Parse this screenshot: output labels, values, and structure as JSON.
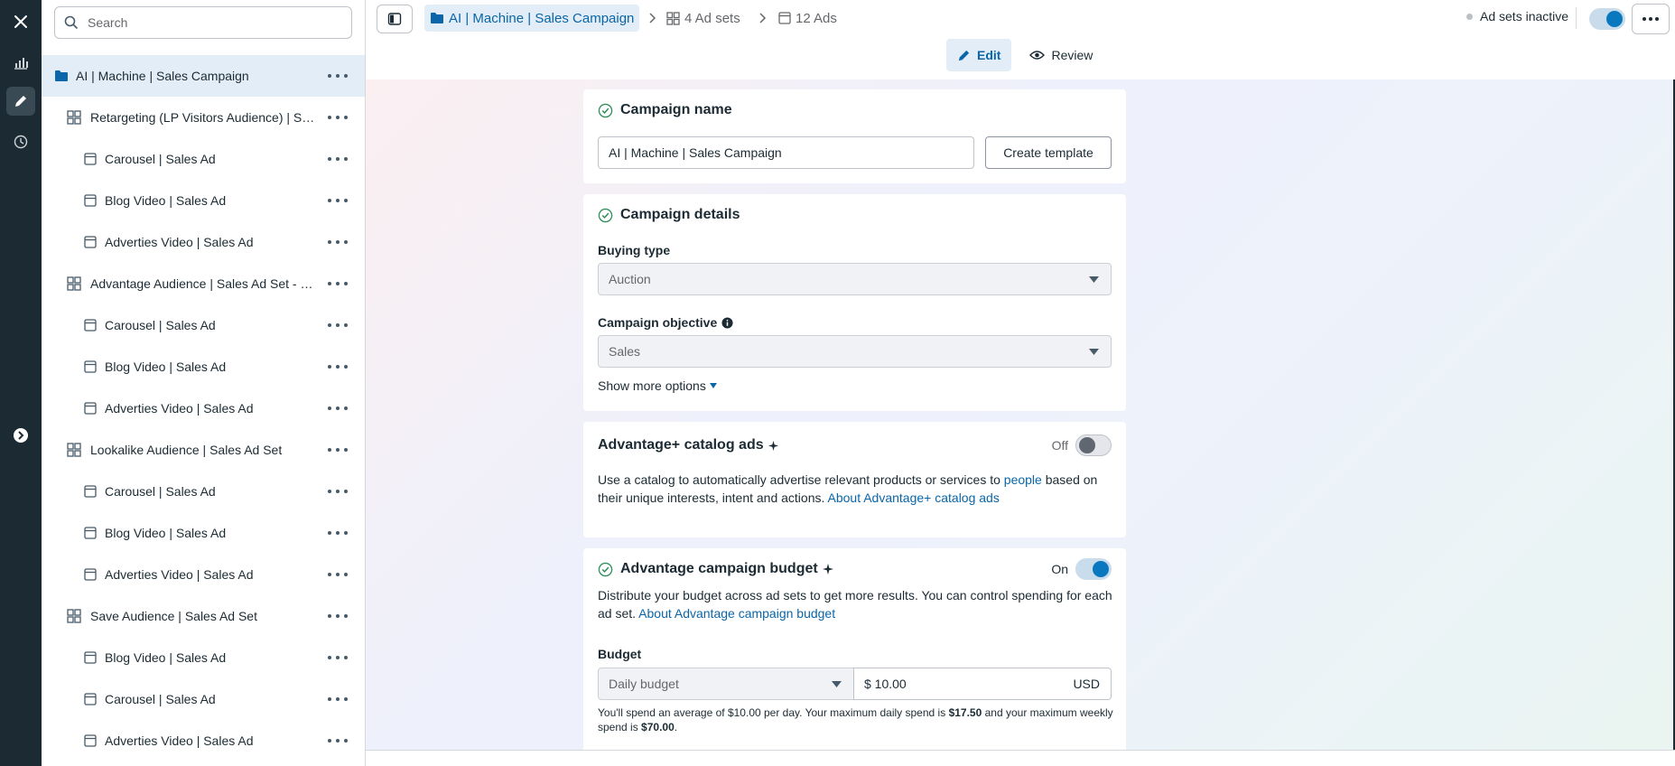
{
  "sidebar": {
    "search_placeholder": "Search",
    "items": [
      {
        "label": "AI | Machine | Sales Campaign",
        "type": "campaign"
      },
      {
        "label": "Retargeting (LP Visitors Audience) | Sal...",
        "type": "adset"
      },
      {
        "label": "Carousel | Sales Ad",
        "type": "ad"
      },
      {
        "label": "Blog Video | Sales Ad",
        "type": "ad"
      },
      {
        "label": "Adverties Video | Sales Ad",
        "type": "ad"
      },
      {
        "label": "Advantage Audience | Sales Ad Set - C...",
        "type": "adset"
      },
      {
        "label": "Carousel | Sales Ad",
        "type": "ad"
      },
      {
        "label": "Blog Video | Sales Ad",
        "type": "ad"
      },
      {
        "label": "Adverties Video | Sales Ad",
        "type": "ad"
      },
      {
        "label": "Lookalike Audience | Sales Ad Set",
        "type": "adset"
      },
      {
        "label": "Carousel | Sales Ad",
        "type": "ad"
      },
      {
        "label": "Blog Video | Sales Ad",
        "type": "ad"
      },
      {
        "label": "Adverties Video | Sales Ad",
        "type": "ad"
      },
      {
        "label": "Save Audience | Sales Ad Set",
        "type": "adset"
      },
      {
        "label": "Blog Video | Sales Ad",
        "type": "ad"
      },
      {
        "label": "Carousel | Sales Ad",
        "type": "ad"
      },
      {
        "label": "Adverties Video | Sales Ad",
        "type": "ad"
      }
    ]
  },
  "header": {
    "breadcrumb_campaign": "AI | Machine | Sales Campaign",
    "breadcrumb_adsets": "4 Ad sets",
    "breadcrumb_ads": "12 Ads",
    "status_text": "Ad sets inactive",
    "edit_label": "Edit",
    "review_label": "Review"
  },
  "campaign_name": {
    "title": "Campaign name",
    "value": "AI | Machine | Sales Campaign",
    "template_button": "Create template"
  },
  "campaign_details": {
    "title": "Campaign details",
    "buying_type_label": "Buying type",
    "buying_type_value": "Auction",
    "objective_label": "Campaign objective",
    "objective_value": "Sales",
    "show_more": "Show more options"
  },
  "catalog": {
    "title": "Advantage+ catalog ads",
    "toggle_label": "Off",
    "desc_1": "Use a catalog to automatically advertise relevant products or services to",
    "desc_link_1": "people",
    "desc_2": "based on their unique interests, intent and actions.",
    "desc_link_2": "About Advantage+ catalog ads"
  },
  "budget_card": {
    "title": "Advantage campaign budget",
    "toggle_label": "On",
    "desc": "Distribute your budget across ad sets to get more results. You can control spending for each ad set.",
    "desc_link": "About Advantage campaign budget",
    "budget_label": "Budget",
    "budget_type": "Daily budget",
    "budget_amount": "$ 10.00",
    "currency": "USD",
    "spend_note_1": "You'll spend an average of $10.00 per day. Your maximum daily spend is",
    "spend_max_daily": "$17.50",
    "spend_note_2": "and your maximum weekly spend is",
    "spend_max_weekly": "$70.00",
    "spend_note_end": "."
  },
  "colors": {
    "accent": "#0a66a8",
    "rail": "#1c2b33",
    "selected": "#e3edf7",
    "toggle_on": "#0a78be"
  }
}
